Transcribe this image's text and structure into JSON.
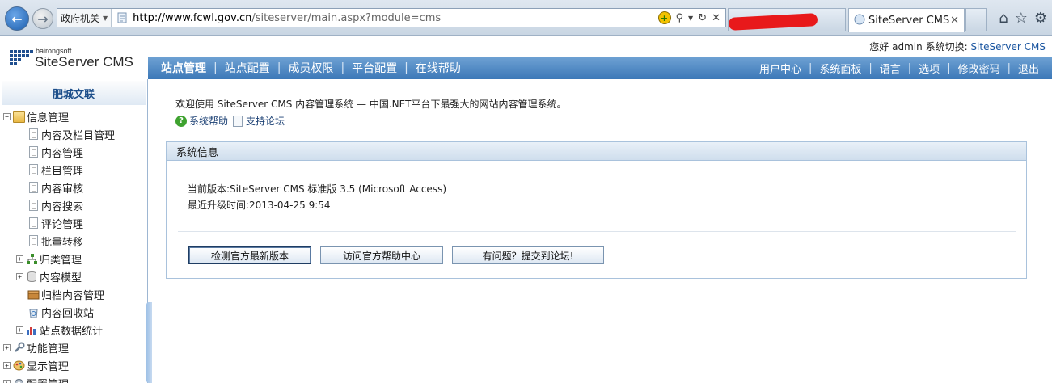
{
  "browser": {
    "zone_label": "政府机关",
    "url_host": "http://www.fcwl.gov.cn",
    "url_path": "/siteserver/main.aspx?module=cms",
    "active_tab_title": "SiteServer CMS...",
    "icons": [
      "back-icon",
      "forward-icon",
      "page-icon",
      "compatibility-icon",
      "search-icon",
      "refresh-icon",
      "stop-icon",
      "home-icon",
      "favorites-icon",
      "settings-icon"
    ]
  },
  "header": {
    "logo_small": "bairongsoft",
    "logo_main": "SiteServer CMS",
    "greeting": "您好",
    "username": "admin",
    "switch_label": "系统切换:",
    "switch_value": "SiteServer CMS"
  },
  "topnav": {
    "left_items": [
      "站点管理",
      "站点配置",
      "成员权限",
      "平台配置",
      "在线帮助"
    ],
    "right_items": [
      "用户中心",
      "系统面板",
      "语言",
      "选项",
      "修改密码",
      "退出"
    ]
  },
  "sidebar": {
    "site_name": "肥城文联",
    "tree": [
      {
        "label": "信息管理",
        "icon": "folder-icon",
        "toggle": "⊟"
      },
      {
        "label": "内容及栏目管理",
        "icon": "page-icon"
      },
      {
        "label": "内容管理",
        "icon": "page-icon"
      },
      {
        "label": "栏目管理",
        "icon": "page-icon"
      },
      {
        "label": "内容审核",
        "icon": "page-icon"
      },
      {
        "label": "内容搜索",
        "icon": "page-icon"
      },
      {
        "label": "评论管理",
        "icon": "page-icon"
      },
      {
        "label": "批量转移",
        "icon": "page-icon"
      },
      {
        "label": "归类管理",
        "icon": "tree-icon",
        "toggle": "⊞"
      },
      {
        "label": "内容模型",
        "icon": "cylinder-icon",
        "toggle": "⊞"
      },
      {
        "label": "归档内容管理",
        "icon": "archive-icon"
      },
      {
        "label": "内容回收站",
        "icon": "recycle-icon"
      },
      {
        "label": "站点数据统计",
        "icon": "chart-icon",
        "toggle": "⊞"
      },
      {
        "label": "功能管理",
        "icon": "wrench-icon",
        "toggle": "⊞"
      },
      {
        "label": "显示管理",
        "icon": "palette-icon",
        "toggle": "⊞"
      },
      {
        "label": "配置管理",
        "icon": "gear-icon",
        "toggle": "⊞"
      }
    ]
  },
  "main": {
    "welcome_text": "欢迎使用 SiteServer CMS 内容管理系统 — 中国.NET平台下最强大的网站内容管理系统。",
    "links": [
      "系统帮助",
      "支持论坛"
    ],
    "panel_title": "系统信息",
    "version_label": "当前版本:",
    "version_value": "SiteServer CMS 标准版 3.5 (Microsoft Access)",
    "upgrade_label": "最近升级时间:",
    "upgrade_value": "2013-04-25 9:54",
    "buttons": [
      "检测官方最新版本",
      "访问官方帮助中心",
      "有问题？提交到论坛!"
    ]
  },
  "colors": {
    "nav_bar": "#4f88c6",
    "site_title": "#1c4e8a",
    "panel_border": "#a9c2dc",
    "redaction": "#e8191b"
  }
}
